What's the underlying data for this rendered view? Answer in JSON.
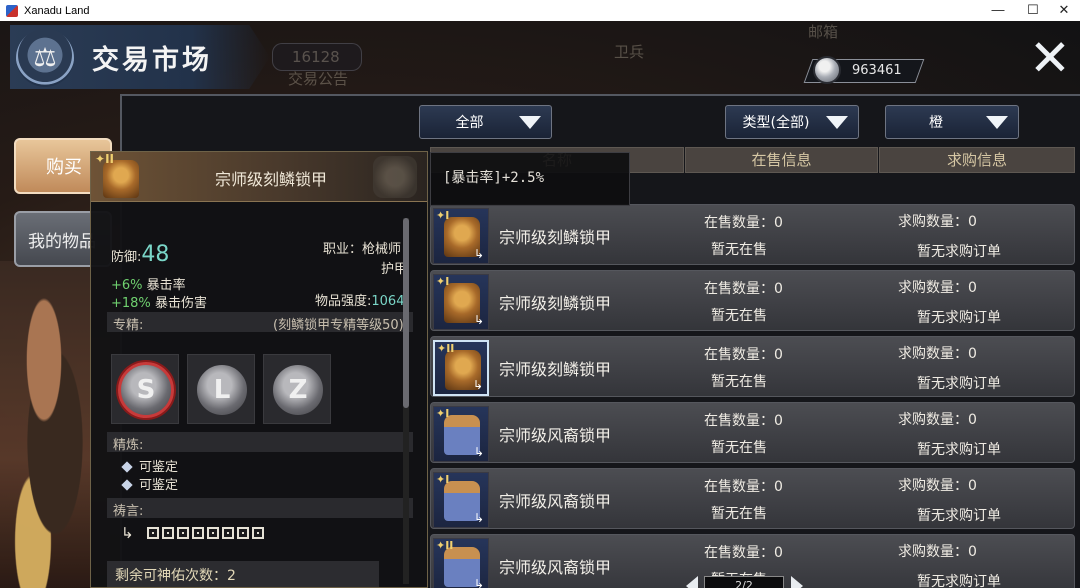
{
  "window": {
    "title": "Xanadu Land",
    "minimize_glyph": "—",
    "maximize_glyph": "☐",
    "close_glyph": "✕"
  },
  "header": {
    "title": "交易市场",
    "emblem_icon": "scales-icon"
  },
  "background_text": {
    "mail": "邮箱",
    "guard": "卫兵",
    "num1": "16128",
    "num2": "963461",
    "notice": "交易公告"
  },
  "currency": {
    "icon": "silver-coin-icon",
    "value": "963461"
  },
  "close_label": "✕",
  "side_tabs": {
    "buy": "购买",
    "mine": "我的物品"
  },
  "filters": {
    "category": "全部",
    "type": "类型(全部)",
    "quality": "橙"
  },
  "columns": {
    "name": "名称",
    "sale_info": "在售信息",
    "buy_info": "求购信息"
  },
  "rows": [
    {
      "tier": "I",
      "name": "宗师级刻鳞锁甲",
      "sale_count": "在售数量：0",
      "sale_status": "暂无在售",
      "buy_count": "求购数量：0",
      "buy_status": "暂无求购订单",
      "armor": "scale",
      "selected": false
    },
    {
      "tier": "I",
      "name": "宗师级刻鳞锁甲",
      "sale_count": "在售数量：0",
      "sale_status": "暂无在售",
      "buy_count": "求购数量：0",
      "buy_status": "暂无求购订单",
      "armor": "scale",
      "selected": false
    },
    {
      "tier": "II",
      "name": "宗师级刻鳞锁甲",
      "sale_count": "在售数量：0",
      "sale_status": "暂无在售",
      "buy_count": "求购数量：0",
      "buy_status": "暂无求购订单",
      "armor": "scale",
      "selected": true
    },
    {
      "tier": "I",
      "name": "宗师级风裔锁甲",
      "sale_count": "在售数量：0",
      "sale_status": "暂无在售",
      "buy_count": "求购数量：0",
      "buy_status": "暂无求购订单",
      "armor": "wind",
      "selected": false
    },
    {
      "tier": "I",
      "name": "宗师级风裔锁甲",
      "sale_count": "在售数量：0",
      "sale_status": "暂无在售",
      "buy_count": "求购数量：0",
      "buy_status": "暂无求购订单",
      "armor": "wind",
      "selected": false
    },
    {
      "tier": "II",
      "name": "宗师级风裔锁甲",
      "sale_count": "在售数量：0",
      "sale_status": "暂无在售",
      "buy_count": "求购数量：0",
      "buy_status": "暂无求购订单",
      "armor": "wind",
      "selected": false
    }
  ],
  "pager": {
    "text": "2/2"
  },
  "tooltip_small": {
    "text": "[暴击率]+2.5%"
  },
  "detail": {
    "tier": "II",
    "title": "宗师级刻鳞锁甲",
    "defense_label": "防御:",
    "defense_value": "48",
    "job": "职业：枪械师",
    "slot": "护甲",
    "stat1_value": "+6%",
    "stat1_name": "暴击率",
    "stat2_value": "+18%",
    "stat2_name": "暴击伤害",
    "strength_label": "物品强度:",
    "strength_value": "1064",
    "spec_label": "专精:",
    "spec_note": "(刻鳞锁甲专精等级50)",
    "spec_icons": [
      "S",
      "L",
      "Z"
    ],
    "refine_label": "精炼:",
    "refine_items": [
      "可鉴定",
      "可鉴定"
    ],
    "prayer_label": "祷言:",
    "prayer_hook": "↳",
    "remaining": "剩余可神佑次数：2"
  },
  "colors": {
    "accent_blue": "#2d3a52",
    "tab_active": "#d8a878",
    "green_stat": "#6fd06f",
    "teal_value": "#7ad6c8",
    "selected_border": "#cfe3f4",
    "spec_active_ring": "#c83a3a"
  }
}
